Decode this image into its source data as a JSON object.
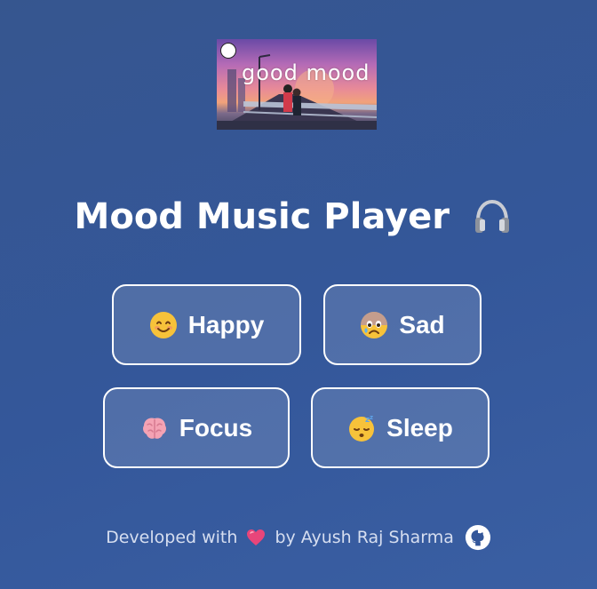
{
  "cover": {
    "title": "good mood",
    "icon": "album-cover-image"
  },
  "header": {
    "title": "Mood Music Player",
    "icon": "headphones-icon"
  },
  "moods": [
    {
      "id": "happy",
      "label": "Happy",
      "icon": "smiling-face-icon"
    },
    {
      "id": "sad",
      "label": "Sad",
      "icon": "sad-face-icon"
    },
    {
      "id": "focus",
      "label": "Focus",
      "icon": "brain-icon"
    },
    {
      "id": "sleep",
      "label": "Sleep",
      "icon": "sleeping-face-icon"
    }
  ],
  "footer": {
    "prefix": "Developed with",
    "suffix": "by Ayush Raj Sharma",
    "heart_icon": "heart-icon",
    "link_icon": "github-icon"
  },
  "colors": {
    "background": "#36568f",
    "button_border": "#ffffff",
    "heart": "#e8457a"
  }
}
